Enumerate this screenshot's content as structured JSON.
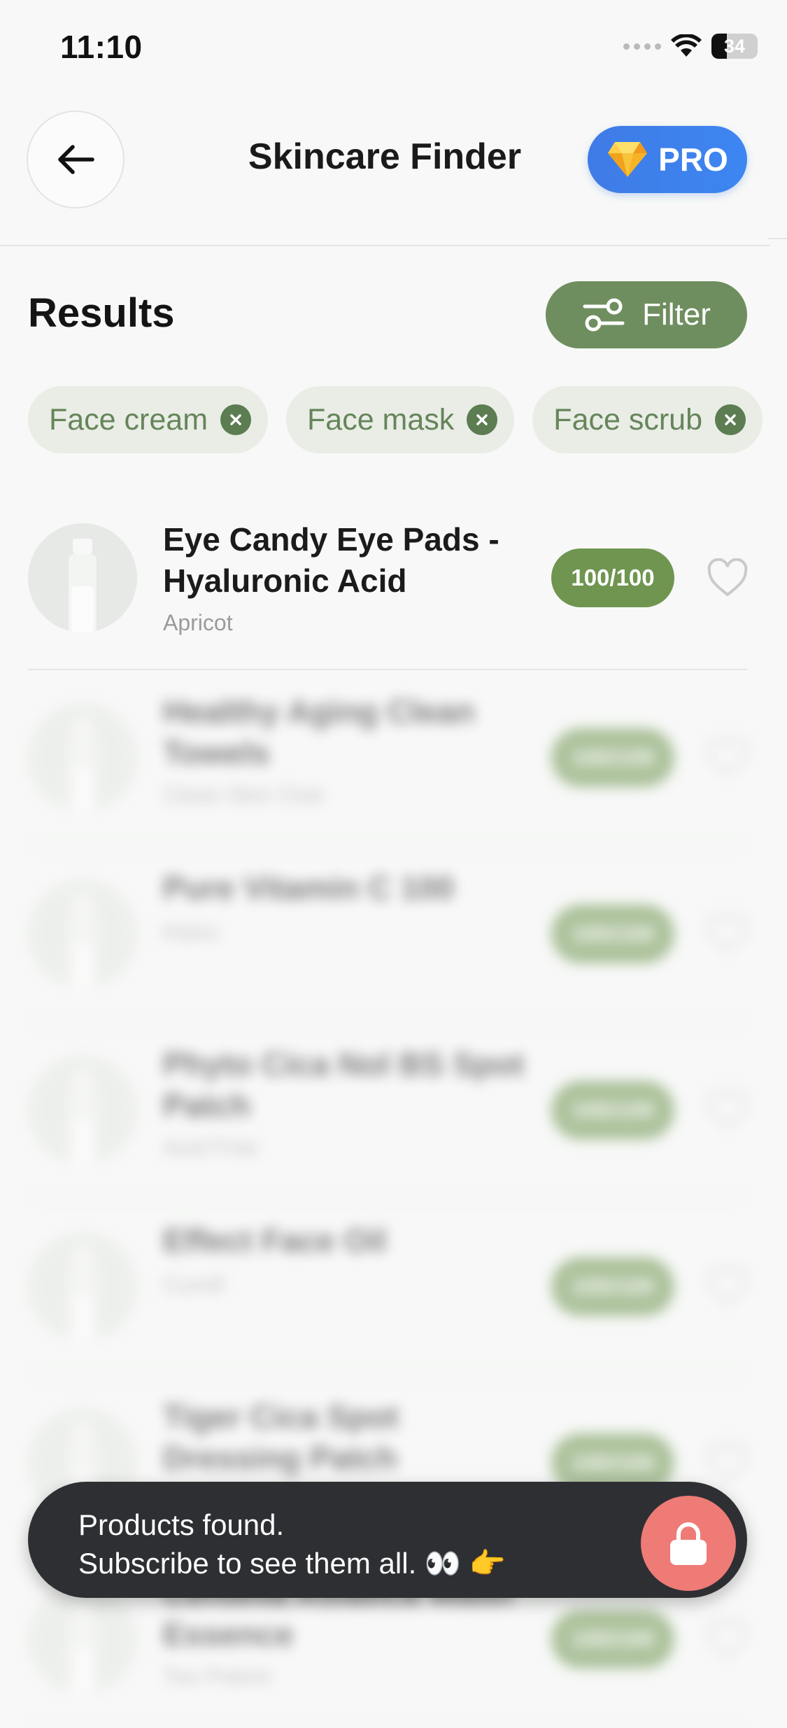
{
  "status_bar": {
    "time": "11:10",
    "battery": "34",
    "battery_level": 0.34
  },
  "header": {
    "title": "Skincare Finder",
    "pro_label": "PRO"
  },
  "results": {
    "title": "Results",
    "filter_label": "Filter"
  },
  "chips": [
    {
      "label": "Face cream"
    },
    {
      "label": "Face mask"
    },
    {
      "label": "Face scrub"
    }
  ],
  "products": [
    {
      "name": "Eye Candy Eye Pads - Hyaluronic Acid",
      "brand": "Apricot",
      "score": "100/100",
      "blurred": false
    },
    {
      "name": "Healthy Aging Clean Towels",
      "brand": "Clean Skin Club",
      "score": "100/100",
      "blurred": true
    },
    {
      "name": "Pure Vitamin C 100",
      "brand": "Klairs",
      "score": "100/100",
      "blurred": true
    },
    {
      "name": "Phyto Cica Nol BS Spot Patch",
      "brand": "Acid Free",
      "score": "100/100",
      "blurred": true
    },
    {
      "name": "Effect Face Oil",
      "brand": "Curotf",
      "score": "100/100",
      "blurred": true
    },
    {
      "name": "Tiger Cica Spot Dressing Patch",
      "brand": "",
      "score": "100/100",
      "blurred": true
    },
    {
      "name": "Centella Asiatica Water Essence",
      "brand": "Too Potent",
      "score": "100/100",
      "blurred": true
    }
  ],
  "toast": {
    "line1": "Products found.",
    "line2": "Subscribe to see them all. 👀 👉"
  },
  "colors": {
    "accent_green": "#6f8e5f",
    "score_green": "#6f9550",
    "pro_blue": "#3d86f2",
    "lock_red": "#ee7b76",
    "toast_bg": "#2e2f33"
  }
}
